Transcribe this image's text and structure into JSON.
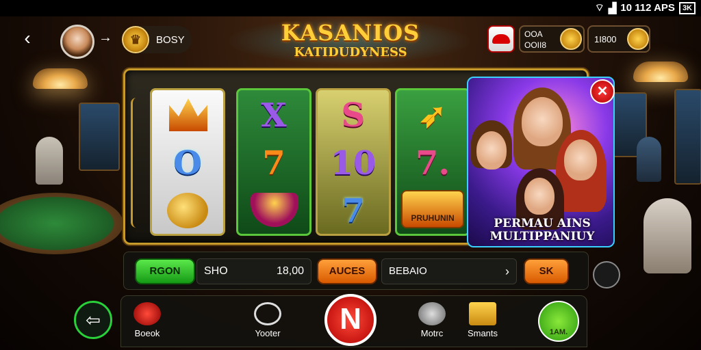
{
  "status_bar": {
    "time": "10 112 APS",
    "battery": "3K"
  },
  "top_bar": {
    "coin_value": "BOSY",
    "balance_line1": "OOA",
    "balance_line2": "OOII8",
    "gems_value": "1I800"
  },
  "logo": {
    "line1": "KASANIOS",
    "line2": "KATIDUDYNESS"
  },
  "reels": [
    {
      "top": "",
      "mid": "O",
      "bot": ""
    },
    {
      "top": "X",
      "mid": "7",
      "bot": ""
    },
    {
      "top": "S",
      "mid": "10",
      "bot": "7"
    },
    {
      "top": "",
      "mid": "7.",
      "bot": "PRUHUNIN"
    }
  ],
  "promo": {
    "line1": "PERMAU AINS",
    "line2": "MULTIPPANIUY"
  },
  "controls": {
    "green_button": "RGON",
    "field_label": "SHO",
    "field_value": "18,00",
    "orange_button_1": "AUCES",
    "dropdown_value": "BEBAIO",
    "orange_button_2": "SK"
  },
  "bottom_nav": [
    {
      "label": "Boeok"
    },
    {
      "label": "Yooter"
    },
    {
      "label": "Motrc"
    },
    {
      "label": "Smants"
    }
  ],
  "auto_label": "1AM.",
  "colors": {
    "accent_gold": "#c89a2a",
    "spin_red": "#d80000",
    "green": "#2ad03a",
    "orange": "#ff8a1a"
  }
}
